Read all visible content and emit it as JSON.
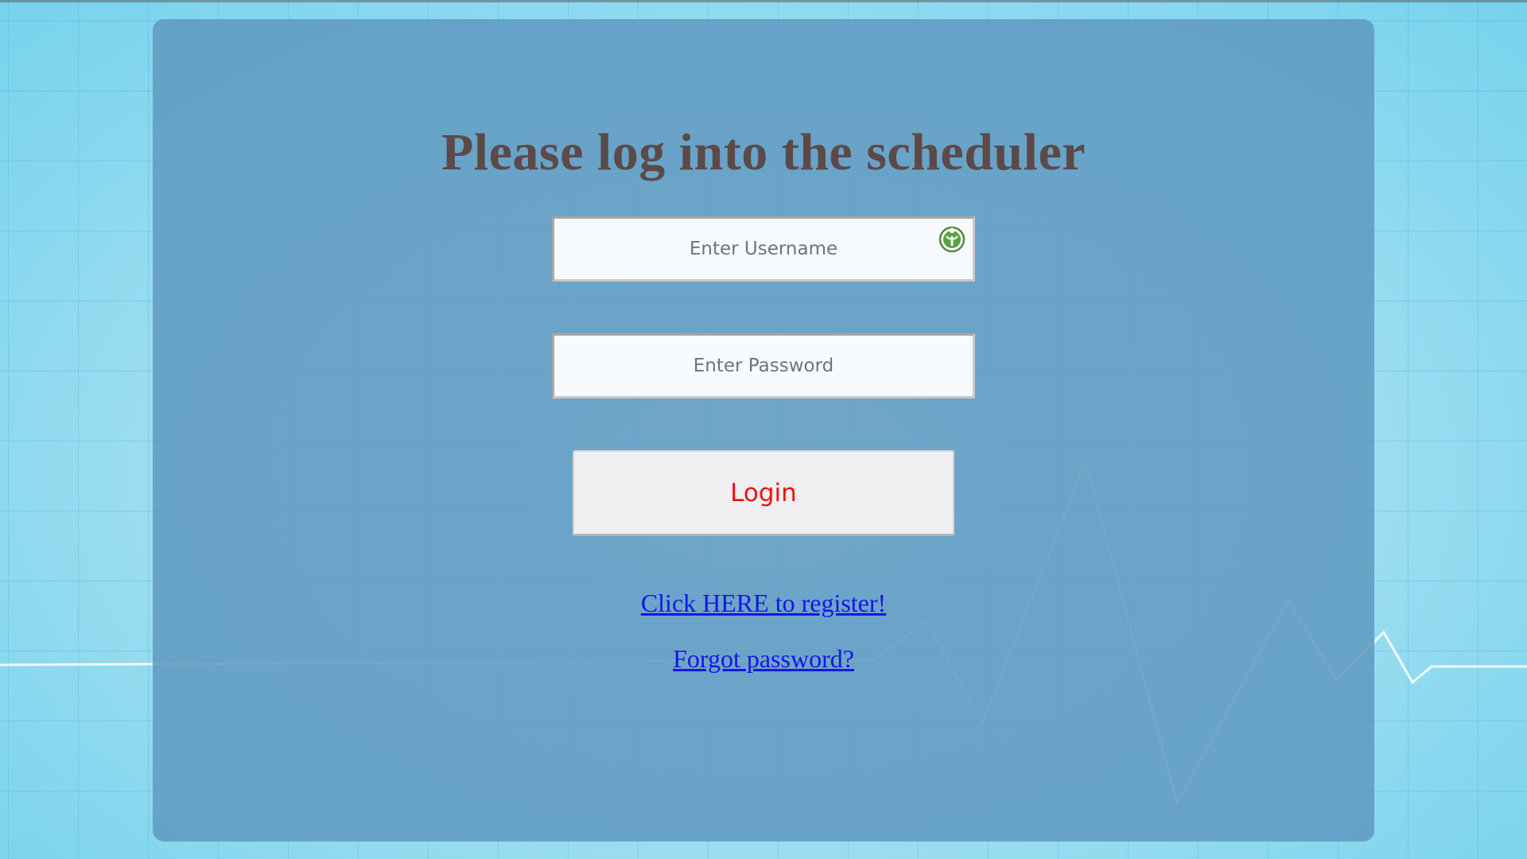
{
  "page": {
    "title": "Please log into the scheduler"
  },
  "form": {
    "username_placeholder": "Enter Username",
    "username_value": "",
    "password_placeholder": "Enter Password",
    "password_value": "",
    "login_label": "Login"
  },
  "links": {
    "register": "Click HERE to register!",
    "forgot": "Forgot password?"
  },
  "icons": {
    "username_field_icon": "password-manager-key-icon"
  },
  "colors": {
    "title": "#5b4a47",
    "login_text": "#ee1111",
    "link": "#1515e8",
    "panel": "#619bc3"
  }
}
